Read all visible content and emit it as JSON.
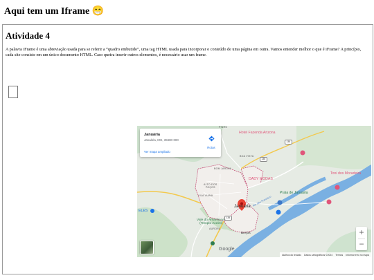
{
  "page": {
    "title": "Aqui tem um Iframe 😁"
  },
  "iframe": {
    "heading": "Atividade 4",
    "paragraph": "A palavra iFrame é uma abreviação usada para se referir a “quadro embutido”, uma tag HTML usada para incorporar o conteúdo de uma página em outra. Vamos entender melhor o que é iFrame? A princípio, cada site consiste em um único documento HTML. Caso queira inserir outros elementos, é necessário usar um frame."
  },
  "map": {
    "place_card": {
      "name": "Januária",
      "address": "Januária, MG, 39480-000",
      "directions_label": "Rotas",
      "larger_map_link": "Ver mapa ampliado"
    },
    "labels": {
      "pinho": "PINHO",
      "boa_vista": "BOA VISTA",
      "bom_jardim": "BOM JARDIM",
      "alto_dos_pocos": "ALTO DOS\nPOÇOS",
      "vila_viana": "VILA VIANA",
      "eles": "ELES",
      "city": "Januária",
      "vale": "Vale do Amanhecer\n(Templo Aceiro)",
      "aurora": "AURORA",
      "brejos": "Brejos",
      "hotel": "Hotel Fazenda Arizona",
      "toni": "Toni dos Moradeira",
      "dady": "DADY MODAS",
      "praia": "Praia de Januária",
      "river": "Rio São Francisco",
      "route_1": "135",
      "route_2": "135",
      "route_3": "135"
    },
    "zoom_in": "+",
    "zoom_out": "−",
    "google": "Google",
    "footer": {
      "shortcuts": "Atalhos do teclado",
      "map_data": "Dados cartográficos ©2024",
      "terms": "Termos",
      "report": "Informar erro no mapa"
    }
  }
}
